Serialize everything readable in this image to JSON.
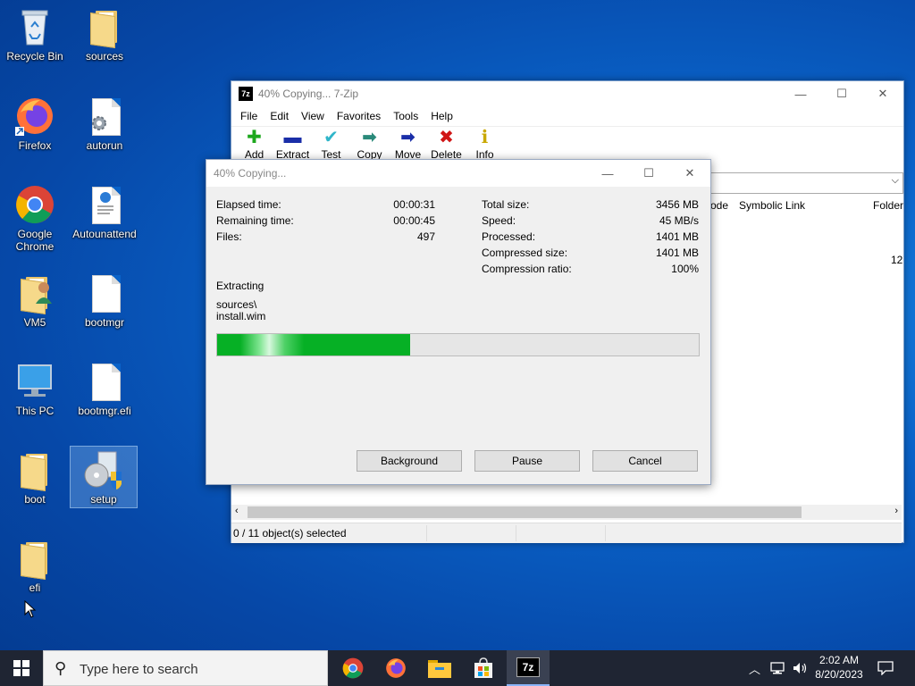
{
  "desktop": {
    "icons": [
      {
        "label": "Recycle Bin",
        "icon": "recycle-bin-icon"
      },
      {
        "label": "sources",
        "icon": "folder-icon"
      },
      {
        "label": "Firefox",
        "icon": "firefox-icon"
      },
      {
        "label": "autorun",
        "icon": "settings-file-icon"
      },
      {
        "label": "Google Chrome",
        "icon": "chrome-icon"
      },
      {
        "label": "Autounattend",
        "icon": "xml-file-icon"
      },
      {
        "label": "VM5",
        "icon": "user-folder-icon"
      },
      {
        "label": "bootmgr",
        "icon": "file-icon"
      },
      {
        "label": "This PC",
        "icon": "computer-icon"
      },
      {
        "label": "bootmgr.efi",
        "icon": "file-icon"
      },
      {
        "label": "boot",
        "icon": "folder-icon"
      },
      {
        "label": "setup",
        "icon": "setup-icon"
      },
      {
        "label": "efi",
        "icon": "folder-icon"
      }
    ]
  },
  "main_window": {
    "title": "40% Copying... 7-Zip",
    "app_icon_text": "7z",
    "menu": [
      "File",
      "Edit",
      "View",
      "Favorites",
      "Tools",
      "Help"
    ],
    "toolbar": [
      {
        "label": "Add",
        "icon": "add-icon",
        "glyph": "✚",
        "color": "#1ea81e"
      },
      {
        "label": "Extract",
        "icon": "extract-icon",
        "glyph": "▬",
        "color": "#1a2ea8"
      },
      {
        "label": "Test",
        "icon": "test-icon",
        "glyph": "✔",
        "color": "#2fb5c9"
      },
      {
        "label": "Copy",
        "icon": "copy-icon",
        "glyph": "➡",
        "color": "#2a8a7a"
      },
      {
        "label": "Move",
        "icon": "move-icon",
        "glyph": "➡",
        "color": "#1a2ea8"
      },
      {
        "label": "Delete",
        "icon": "delete-icon",
        "glyph": "✖",
        "color": "#d01515"
      },
      {
        "label": "Info",
        "icon": "info-icon",
        "glyph": "ℹ",
        "color": "#c9a800"
      }
    ],
    "columns": [
      "ode",
      "Symbolic Link",
      "Folder"
    ],
    "visible_cell": "12",
    "status": "0 / 11 object(s) selected"
  },
  "dialog": {
    "title": "40% Copying...",
    "left_stats": [
      {
        "label": "Elapsed time:",
        "value": "00:00:31"
      },
      {
        "label": "Remaining time:",
        "value": "00:00:45"
      },
      {
        "label": "Files:",
        "value": "497"
      }
    ],
    "right_stats": [
      {
        "label": "Total size:",
        "value": "3456 MB"
      },
      {
        "label": "Speed:",
        "value": "45 MB/s"
      },
      {
        "label": "Processed:",
        "value": "1401 MB"
      },
      {
        "label": "Compressed size:",
        "value": "1401 MB"
      },
      {
        "label": "Compression ratio:",
        "value": "100%"
      }
    ],
    "operation": "Extracting",
    "current_path": "sources\\",
    "current_file": "install.wim",
    "progress_fraction": 0.4,
    "buttons": {
      "background": "Background",
      "pause": "Pause",
      "cancel": "Cancel"
    }
  },
  "taskbar": {
    "search_placeholder": "Type here to search",
    "apps": [
      "chrome-icon",
      "firefox-icon",
      "file-explorer-icon",
      "store-icon",
      "7zip-icon"
    ],
    "active_app_text": "7z",
    "time": "2:02 AM",
    "date": "8/20/2023"
  }
}
